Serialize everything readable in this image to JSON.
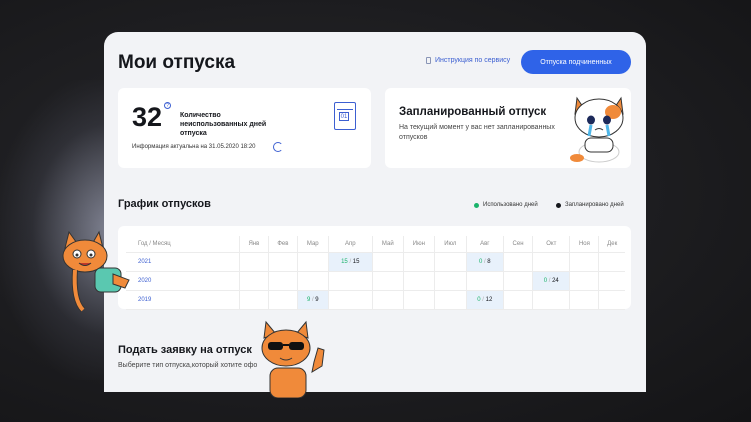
{
  "page": {
    "title": "Мои отпуска"
  },
  "header": {
    "help_link": "Инструкция по сервису",
    "subordinates_button": "Отпуска подчиненных"
  },
  "unused_card": {
    "count": "32",
    "help_mark": "?",
    "label": "Количество неиспользованных дней отпуска",
    "calendar_day": "01",
    "info": "Информация актуальна на 31.05.2020 18:20"
  },
  "planned_card": {
    "title": "Запланированный отпуск",
    "text": "На текущий момент у вас нет запланированных отпусков"
  },
  "schedule": {
    "title": "График отпусков",
    "legend": {
      "used": "Использовано дней",
      "planned": "Запланировано дней",
      "used_color": "#1ab36b",
      "planned_color": "#15171c"
    },
    "header_first": "Год / Месяц",
    "months": [
      "Янв",
      "Фев",
      "Мар",
      "Апр",
      "Май",
      "Июн",
      "Июл",
      "Авг",
      "Сен",
      "Окт",
      "Ноя",
      "Дек"
    ],
    "rows": [
      {
        "year": "2021",
        "cells": {
          "3": {
            "used": "15",
            "planned": "15"
          },
          "7": {
            "used": "0",
            "planned": "8"
          }
        }
      },
      {
        "year": "2020",
        "cells": {
          "9": {
            "used": "0",
            "planned": "24"
          }
        }
      },
      {
        "year": "2019",
        "cells": {
          "2": {
            "used": "9",
            "planned": "9"
          },
          "7": {
            "used": "0",
            "planned": "12"
          }
        }
      }
    ]
  },
  "apply": {
    "title": "Подать заявку на отпуск",
    "subtitle": "Выберите тип отпуска,который хотите офо"
  },
  "colors": {
    "accent": "#2f63e8",
    "highlight": "#e8f1fb"
  }
}
